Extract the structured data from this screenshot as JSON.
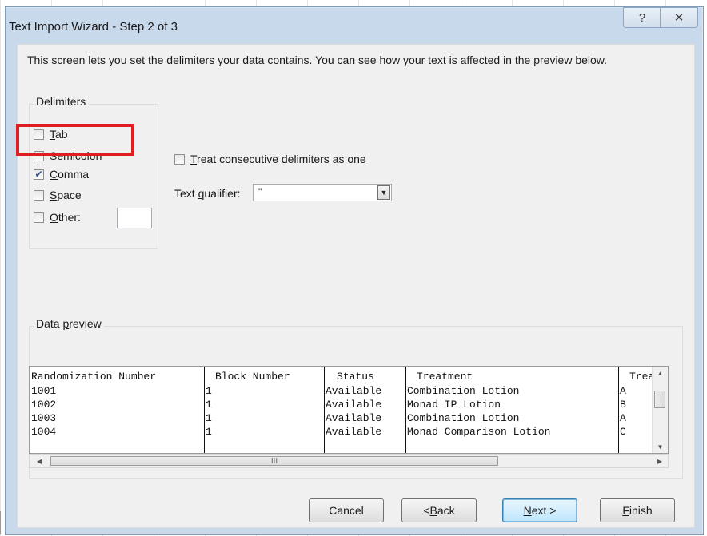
{
  "dialog": {
    "title": "Text Import Wizard - Step 2 of 3",
    "help_glyph": "?",
    "close_glyph": "✕",
    "intro": "This screen lets you set the delimiters your data contains.  You can see how your text is affected in the preview below."
  },
  "delimiters": {
    "group_label": "Delimiters",
    "tab": {
      "label_u": "T",
      "label_rest": "ab",
      "checked": false
    },
    "semicolon": {
      "label_u": "",
      "label_rest": "Semicolon",
      "checked": false
    },
    "comma": {
      "label_u": "C",
      "label_rest": "omma",
      "checked": true
    },
    "space": {
      "label_u": "S",
      "label_rest": "pace",
      "checked": false
    },
    "other": {
      "label_u": "O",
      "label_rest": "ther:",
      "checked": false,
      "value": ""
    },
    "check_glyph": "✔"
  },
  "options": {
    "consecutive_u": "T",
    "consecutive_mid": "r",
    "consecutive_rest": "eat consecutive delimiters as one",
    "qualifier_pre": "Text ",
    "qualifier_u": "q",
    "qualifier_rest": "ualifier:",
    "qualifier_value": "\"",
    "dropdown_glyph": "▼"
  },
  "preview": {
    "group_label_pre": "Data ",
    "group_label_u": "p",
    "group_label_rest": "review",
    "columns": [
      "Randomization Number",
      "Block Number",
      "Status",
      "Treatment",
      "Treat"
    ],
    "rows": [
      [
        "1001",
        "1",
        "Available",
        "Combination Lotion",
        "A"
      ],
      [
        "1002",
        "1",
        "Available",
        "Monad IP Lotion",
        "B"
      ],
      [
        "1003",
        "1",
        "Available",
        "Combination Lotion",
        "A"
      ],
      [
        "1004",
        "1",
        "Available",
        "Monad Comparison Lotion",
        "C"
      ]
    ],
    "hscroll_grip": "III"
  },
  "buttons": {
    "cancel": "Cancel",
    "back_pre": "< ",
    "back_u": "B",
    "back_rest": "ack",
    "next_u": "N",
    "next_rest": "ext >",
    "finish_u": "F",
    "finish_rest": "inish"
  },
  "colors": {
    "highlight": "#e01d22",
    "default_button": "#3c7fb1"
  }
}
